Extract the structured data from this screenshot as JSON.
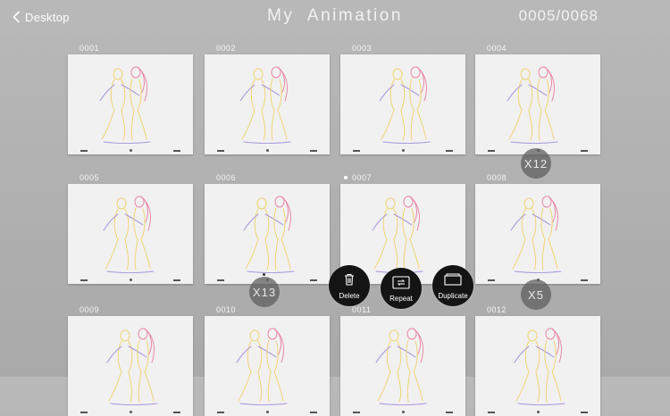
{
  "header": {
    "back_label": "Desktop",
    "title": "My  Animation",
    "counter": "0005/0068"
  },
  "frames": [
    {
      "num": "0001"
    },
    {
      "num": "0002"
    },
    {
      "num": "0003"
    },
    {
      "num": "0004"
    },
    {
      "num": "0005"
    },
    {
      "num": "0006"
    },
    {
      "num": "0007"
    },
    {
      "num": "0008"
    },
    {
      "num": "0009"
    },
    {
      "num": "0010"
    },
    {
      "num": "0011"
    },
    {
      "num": "0012"
    }
  ],
  "repeat_badges": {
    "frame_0004": "X12",
    "frame_0006": "X13",
    "frame_0008": "X5"
  },
  "actions": {
    "delete_label": "Delete",
    "repeat_label": "Repeat",
    "duplicate_label": "Duplicate"
  },
  "colors": {
    "sketch_pink": "#e8789a",
    "sketch_yellow": "#f0d060",
    "sketch_purple": "#9a86d8",
    "action_bg": "#141414"
  }
}
